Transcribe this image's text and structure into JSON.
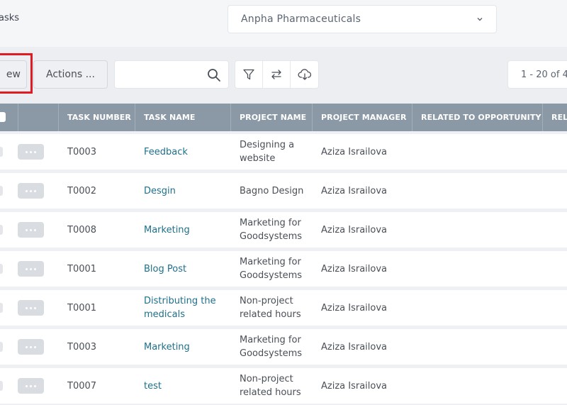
{
  "header": {
    "breadcrumb": "asks",
    "company_select": {
      "value": "Anpha Pharmaceuticals",
      "icon": "chevron-down-icon"
    }
  },
  "toolbar": {
    "new_label": "ew",
    "actions_label": "Actions ...",
    "search": {
      "value": "",
      "placeholder": "",
      "icon": "search-icon"
    },
    "icons": [
      "filter-icon",
      "swap-icon",
      "cloud-download-icon"
    ],
    "pagination": "1 - 20 of 4",
    "highlight_color": "#e11b22"
  },
  "table": {
    "columns": [
      "TASK NUMBER",
      "TASK NAME",
      "PROJECT NAME",
      "PROJECT MANAGER",
      "RELATED TO OPPORTUNITY",
      "REL"
    ],
    "rows": [
      {
        "task_number": "T0003",
        "task_name": "Feedback",
        "project_name": "Designing a website",
        "project_manager": "Aziza Israilova",
        "related_opportunity": ""
      },
      {
        "task_number": "T0002",
        "task_name": "Desgin",
        "project_name": "Bagno Design",
        "project_manager": "Aziza Israilova",
        "related_opportunity": ""
      },
      {
        "task_number": "T0008",
        "task_name": "Marketing",
        "project_name": "Marketing for Goodsystems",
        "project_manager": "Aziza Israilova",
        "related_opportunity": ""
      },
      {
        "task_number": "T0001",
        "task_name": "Blog Post",
        "project_name": "Marketing for Goodsystems",
        "project_manager": "Aziza Israilova",
        "related_opportunity": ""
      },
      {
        "task_number": "T0001",
        "task_name": "Distributing the medicals",
        "project_name": "Non-project related hours",
        "project_manager": "Aziza Israilova",
        "related_opportunity": ""
      },
      {
        "task_number": "T0003",
        "task_name": "Marketing",
        "project_name": "Marketing for Goodsystems",
        "project_manager": "Aziza Israilova",
        "related_opportunity": ""
      },
      {
        "task_number": "T0007",
        "task_name": "test",
        "project_name": "Non-project related hours",
        "project_manager": "Aziza Israilova",
        "related_opportunity": ""
      }
    ]
  }
}
